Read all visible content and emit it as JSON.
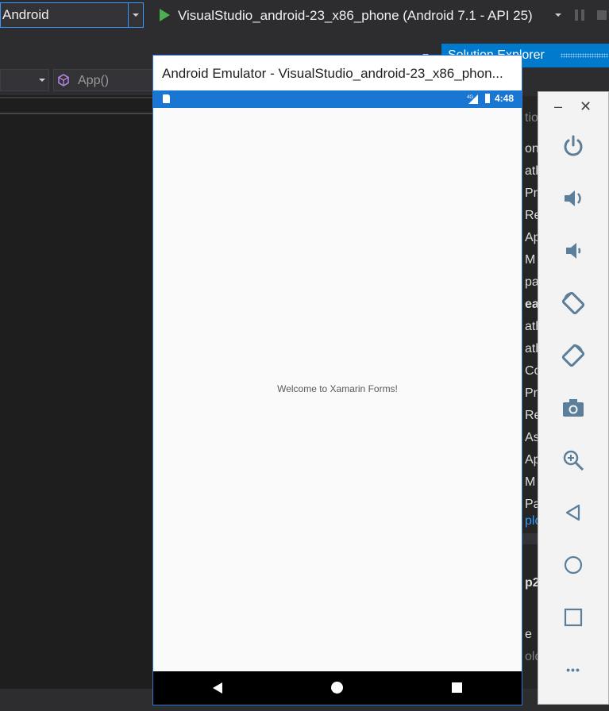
{
  "toolbar": {
    "platform": "Android",
    "run_target": "VisualStudio_android-23_x86_phone (Android 7.1 - API 25)"
  },
  "nav": {
    "member": "App()"
  },
  "solution_explorer": {
    "title": "Solution Explorer",
    "fragments": [
      "tio",
      "on",
      "ath",
      "Pr",
      "Re",
      "Ap",
      "M",
      "pa",
      "eat",
      "ath",
      "ath",
      "Co",
      "Pr",
      "Re",
      "As",
      "Ap",
      "M",
      "Pa",
      "plo",
      "p2",
      "e",
      "old"
    ]
  },
  "emulator": {
    "title": "Android Emulator - VisualStudio_android-23_x86_phon...",
    "clock": "4:48",
    "network": "4G",
    "welcome": "Welcome to Xamarin Forms!",
    "controls": {
      "minimize": "–",
      "close": "✕",
      "more": "•••"
    }
  },
  "colors": {
    "accent": "#007acc",
    "phone_status": "#1976d2",
    "side_icons": "#5b7f9a"
  },
  "icons": [
    "power-icon",
    "volume-up-icon",
    "volume-down-icon",
    "rotate-left-icon",
    "rotate-right-icon",
    "camera-icon",
    "zoom-icon",
    "back-icon",
    "home-icon",
    "overview-icon",
    "more-icon"
  ]
}
